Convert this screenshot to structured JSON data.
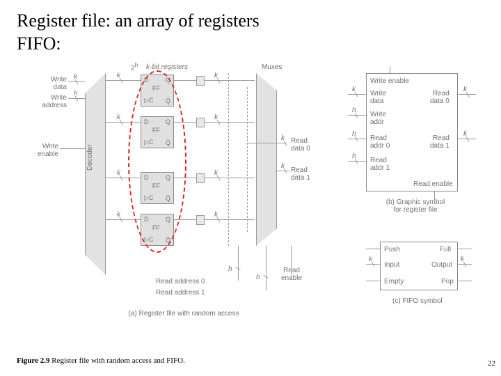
{
  "title_line1": "Register file: an array of registers",
  "title_line2": "FIFO:",
  "labels": {
    "two_h": "2",
    "two_h_sup": "h",
    "kbit_registers": "k-bit registers",
    "muxes": "Muxes",
    "write_data": "Write\ndata",
    "write_address": "Write\naddress",
    "write_enable": "Write\nenable",
    "decoder": "Decoder",
    "read_data0": "Read\ndata 0",
    "read_data1": "Read\ndata 1",
    "read_enable": "Read\nenable",
    "read_address0": "Read address 0",
    "read_address1": "Read address 1",
    "k": "k",
    "h": "h",
    "D": "D",
    "Q": "Q",
    "Qbar": "Q̄",
    "C": "C",
    "FF": "FF",
    "rf_write_enable": "Write enable",
    "rf_write_data": "Write\ndata",
    "rf_write_addr": "Write\naddr",
    "rf_read_addr0": "Read\naddr 0",
    "rf_read_addr1": "Read\naddr 1",
    "rf_read_data0": "Read\ndata 0",
    "rf_read_data1": "Read\ndata 1",
    "rf_read_enable": "Read enable",
    "symbol_b": "(b) Graphic symbol\nfor register file",
    "push": "Push",
    "input": "Input",
    "empty": "Empty",
    "full": "Full",
    "output": "Output",
    "pop": "Pop",
    "symbol_c": "(c) FIFO symbol",
    "caption_a": "(a) Register file with random access"
  },
  "caption": {
    "bold": "Figure 2.9",
    "rest": "  Register file with random access and FIFO."
  },
  "page_number": "22"
}
